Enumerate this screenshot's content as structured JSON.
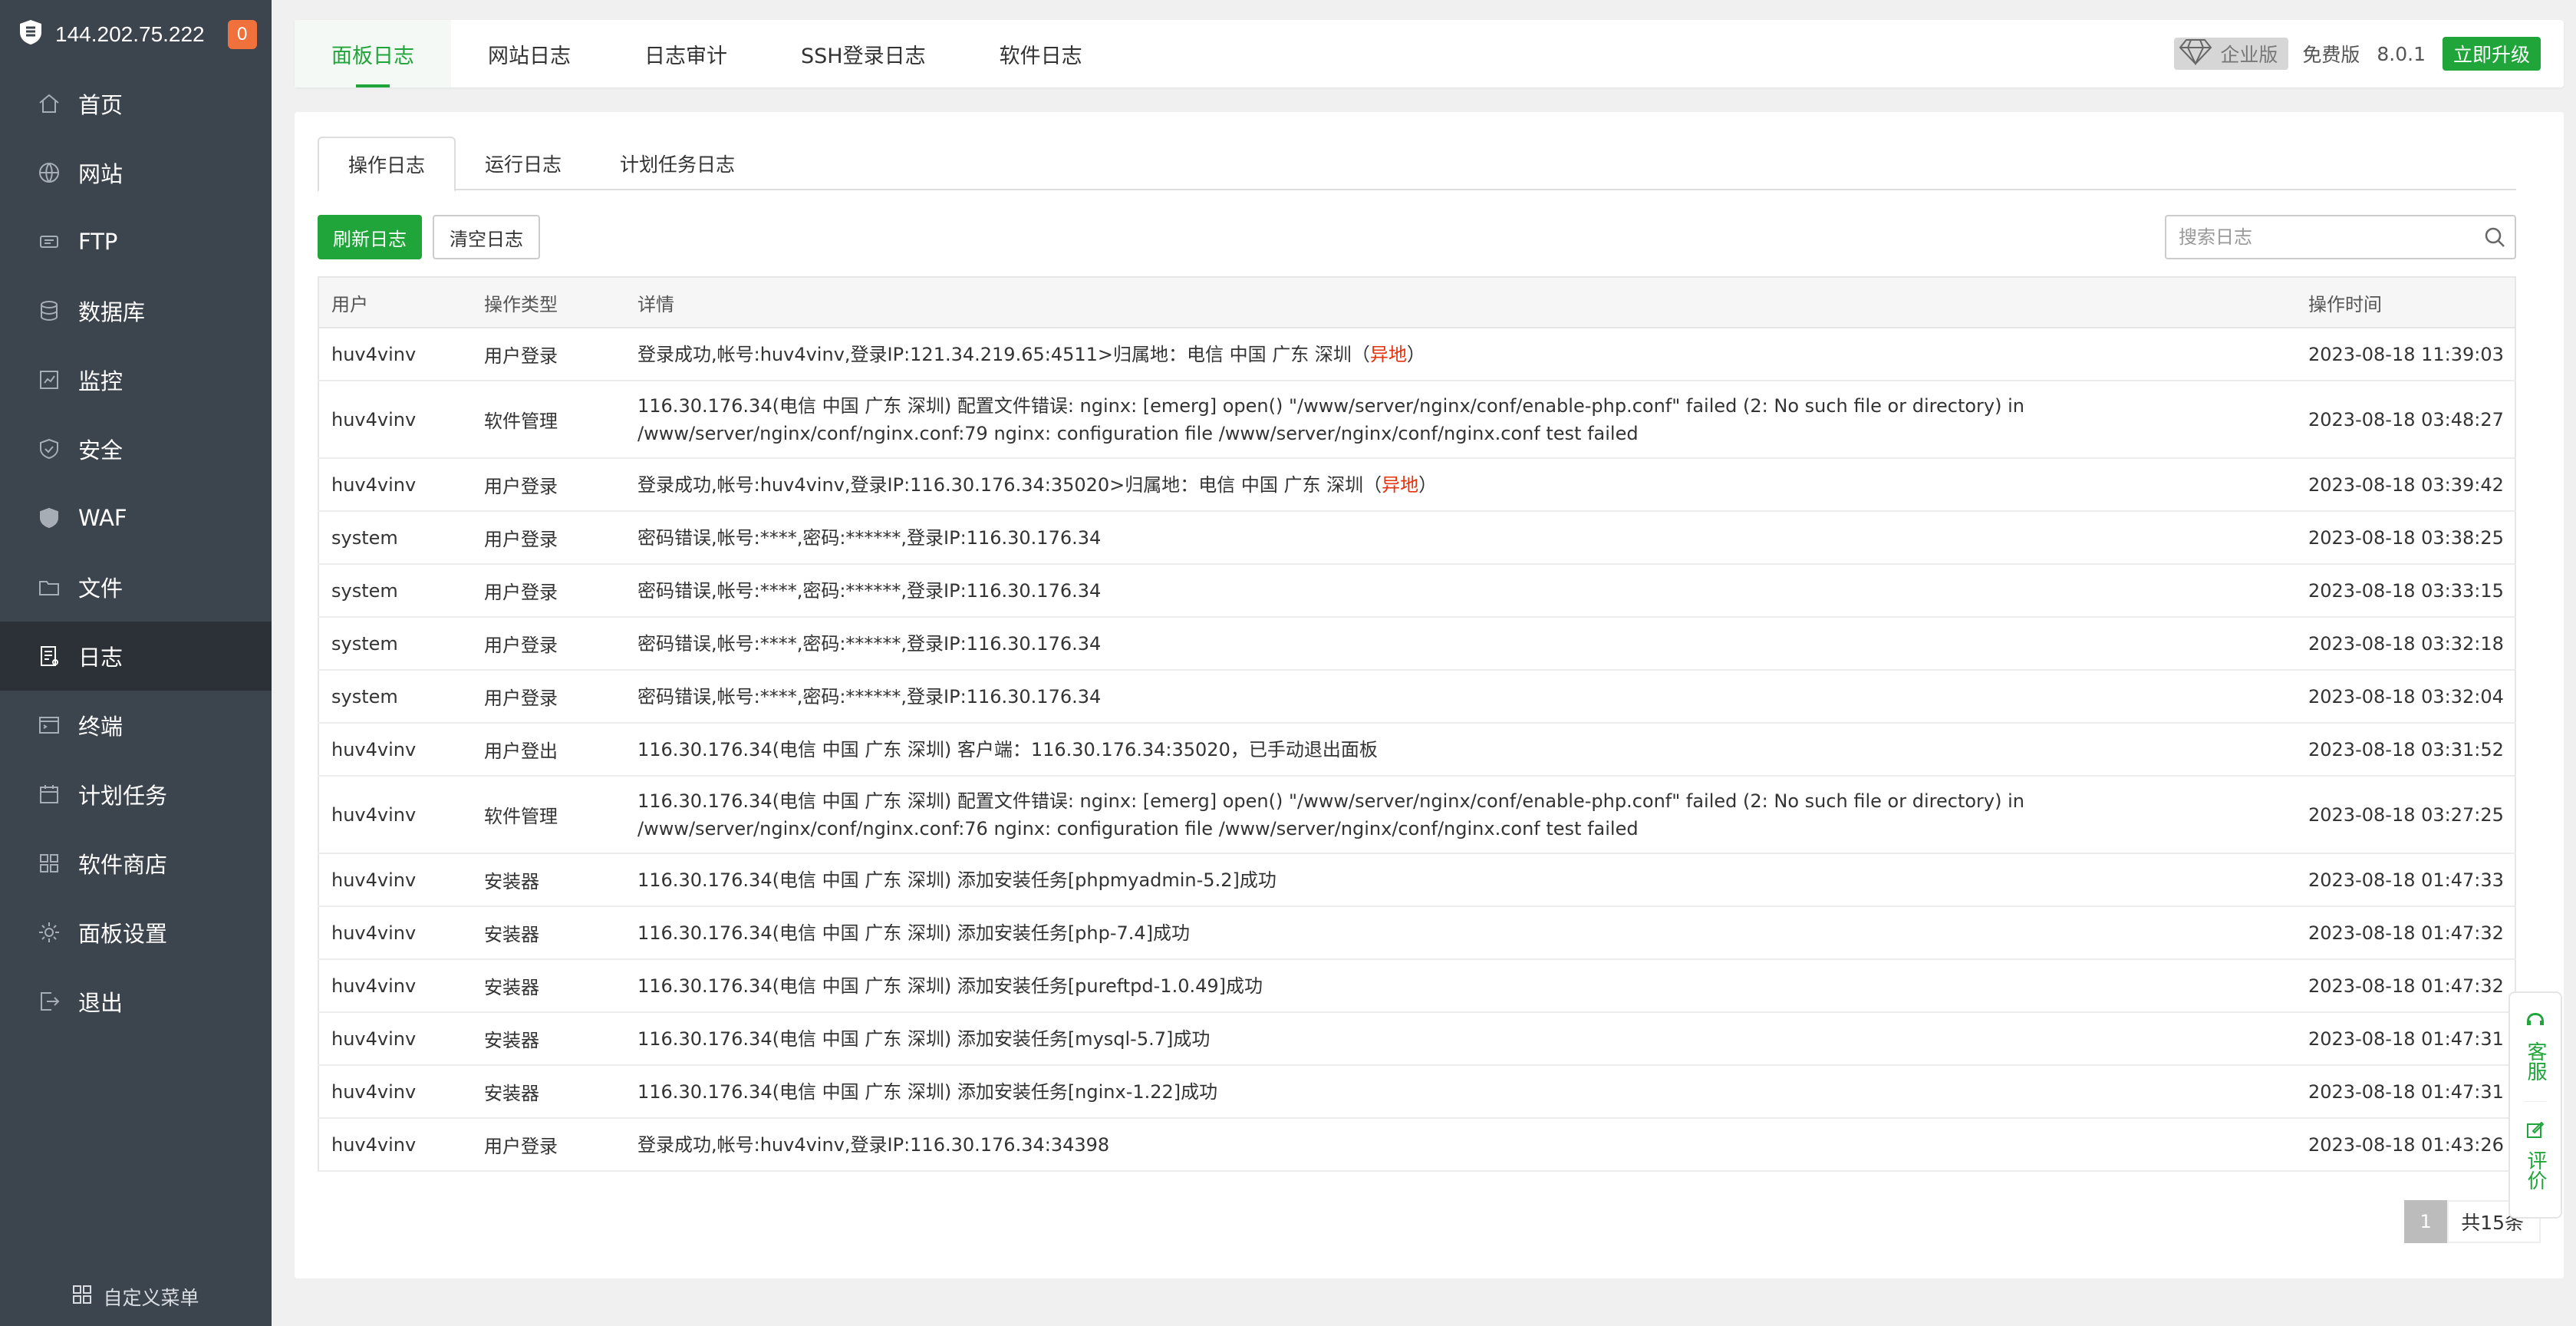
{
  "sidebar": {
    "server_ip": "144.202.75.222",
    "badge_count": "0",
    "items": [
      {
        "label": "首页",
        "icon": "home-icon"
      },
      {
        "label": "网站",
        "icon": "globe-icon"
      },
      {
        "label": "FTP",
        "icon": "ftp-icon"
      },
      {
        "label": "数据库",
        "icon": "database-icon"
      },
      {
        "label": "监控",
        "icon": "monitor-icon"
      },
      {
        "label": "安全",
        "icon": "shield-icon"
      },
      {
        "label": "WAF",
        "icon": "waf-shield-icon"
      },
      {
        "label": "文件",
        "icon": "folder-icon"
      },
      {
        "label": "日志",
        "icon": "log-icon",
        "active": true
      },
      {
        "label": "终端",
        "icon": "terminal-icon"
      },
      {
        "label": "计划任务",
        "icon": "calendar-icon"
      },
      {
        "label": "软件商店",
        "icon": "grid-icon"
      },
      {
        "label": "面板设置",
        "icon": "gear-icon"
      },
      {
        "label": "退出",
        "icon": "logout-icon"
      }
    ],
    "custom_menu": "自定义菜单"
  },
  "topbar": {
    "tabs": [
      "面板日志",
      "网站日志",
      "日志审计",
      "SSH登录日志",
      "软件日志"
    ],
    "active_tab": 0,
    "edition": "企业版",
    "free": "免费版",
    "version": "8.0.1",
    "upgrade": "立即升级"
  },
  "subtabs": [
    "操作日志",
    "运行日志",
    "计划任务日志"
  ],
  "toolbar": {
    "refresh": "刷新日志",
    "clear": "清空日志",
    "search_placeholder": "搜索日志"
  },
  "table": {
    "headers": [
      "用户",
      "操作类型",
      "详情",
      "操作时间"
    ],
    "rows": [
      {
        "user": "huv4vinv",
        "type": "用户登录",
        "detail": "登录成功,帐号:huv4vinv,登录IP:121.34.219.65:4511>归属地：电信 中国 广东 深圳（",
        "flag": "异地",
        "detail_end": "）",
        "time": "2023-08-18 11:39:03"
      },
      {
        "user": "huv4vinv",
        "type": "软件管理",
        "detail": "116.30.176.34(电信 中国 广东 深圳) 配置文件错误: nginx: [emerg] open() \"/www/server/nginx/conf/enable-php.conf\" failed (2: No such file or directory) in /www/server/nginx/conf/nginx.conf:79 nginx: configuration file /www/server/nginx/conf/nginx.conf test failed",
        "time": "2023-08-18 03:48:27",
        "tall": true
      },
      {
        "user": "huv4vinv",
        "type": "用户登录",
        "detail": "登录成功,帐号:huv4vinv,登录IP:116.30.176.34:35020>归属地：电信 中国 广东 深圳（",
        "flag": "异地",
        "detail_end": "）",
        "time": "2023-08-18 03:39:42"
      },
      {
        "user": "system",
        "type": "用户登录",
        "detail": "密码错误,帐号:****,密码:******,登录IP:116.30.176.34",
        "time": "2023-08-18 03:38:25"
      },
      {
        "user": "system",
        "type": "用户登录",
        "detail": "密码错误,帐号:****,密码:******,登录IP:116.30.176.34",
        "time": "2023-08-18 03:33:15"
      },
      {
        "user": "system",
        "type": "用户登录",
        "detail": "密码错误,帐号:****,密码:******,登录IP:116.30.176.34",
        "time": "2023-08-18 03:32:18"
      },
      {
        "user": "system",
        "type": "用户登录",
        "detail": "密码错误,帐号:****,密码:******,登录IP:116.30.176.34",
        "time": "2023-08-18 03:32:04"
      },
      {
        "user": "huv4vinv",
        "type": "用户登出",
        "detail": "116.30.176.34(电信 中国 广东 深圳) 客户端：116.30.176.34:35020，已手动退出面板",
        "time": "2023-08-18 03:31:52"
      },
      {
        "user": "huv4vinv",
        "type": "软件管理",
        "detail": "116.30.176.34(电信 中国 广东 深圳) 配置文件错误: nginx: [emerg] open() \"/www/server/nginx/conf/enable-php.conf\" failed (2: No such file or directory) in /www/server/nginx/conf/nginx.conf:76 nginx: configuration file /www/server/nginx/conf/nginx.conf test failed",
        "time": "2023-08-18 03:27:25",
        "tall": true
      },
      {
        "user": "huv4vinv",
        "type": "安装器",
        "detail": "116.30.176.34(电信 中国 广东 深圳) 添加安装任务[phpmyadmin-5.2]成功",
        "time": "2023-08-18 01:47:33"
      },
      {
        "user": "huv4vinv",
        "type": "安装器",
        "detail": "116.30.176.34(电信 中国 广东 深圳) 添加安装任务[php-7.4]成功",
        "time": "2023-08-18 01:47:32"
      },
      {
        "user": "huv4vinv",
        "type": "安装器",
        "detail": "116.30.176.34(电信 中国 广东 深圳) 添加安装任务[pureftpd-1.0.49]成功",
        "time": "2023-08-18 01:47:32"
      },
      {
        "user": "huv4vinv",
        "type": "安装器",
        "detail": "116.30.176.34(电信 中国 广东 深圳) 添加安装任务[mysql-5.7]成功",
        "time": "2023-08-18 01:47:31"
      },
      {
        "user": "huv4vinv",
        "type": "安装器",
        "detail": "116.30.176.34(电信 中国 广东 深圳) 添加安装任务[nginx-1.22]成功",
        "time": "2023-08-18 01:47:31"
      },
      {
        "user": "huv4vinv",
        "type": "用户登录",
        "detail": "登录成功,帐号:huv4vinv,登录IP:116.30.176.34:34398",
        "time": "2023-08-18 01:43:26"
      }
    ]
  },
  "pagination": {
    "current": "1",
    "total": "共15条"
  },
  "float_widget": {
    "support": "客服",
    "review": "评价"
  },
  "colors": {
    "accent": "#20a53a",
    "sidebar_bg": "#3c444d",
    "sidebar_active": "#2c3138",
    "badge": "#f0713b",
    "flag": "#e6320f"
  }
}
